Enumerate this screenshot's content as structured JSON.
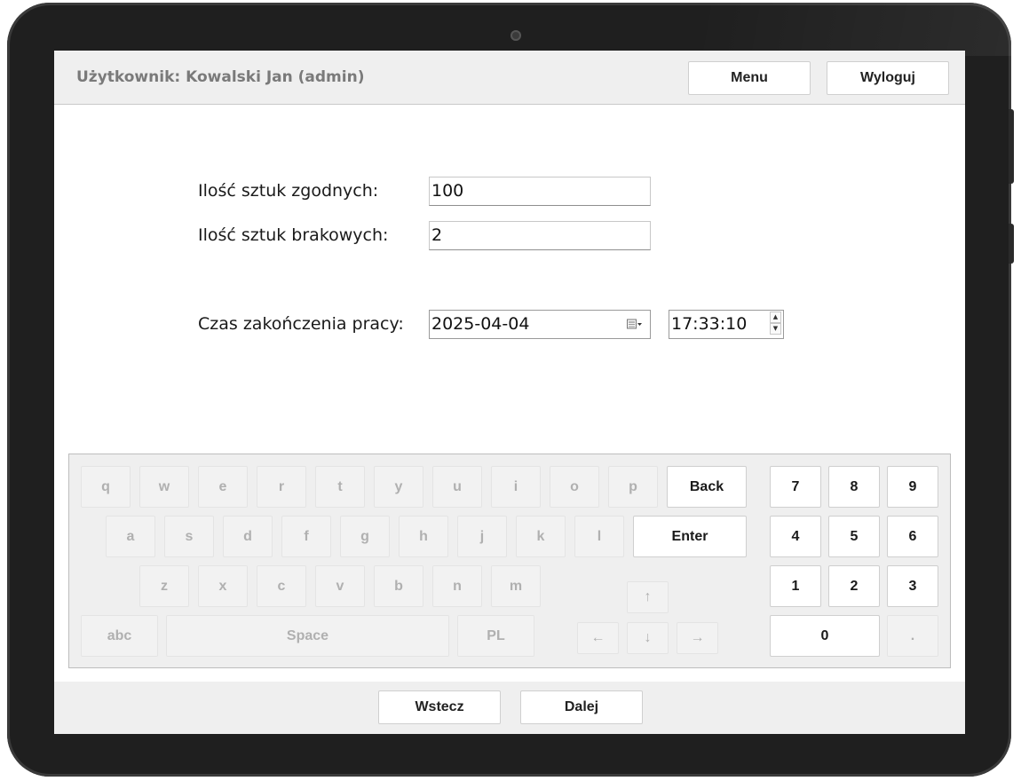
{
  "header": {
    "user_label": "Użytkownik: Kowalski Jan (admin)",
    "menu_label": "Menu",
    "logout_label": "Wyloguj"
  },
  "form": {
    "good_label": "Ilość sztuk zgodnych:",
    "good_value": "100",
    "defect_label": "Ilość sztuk brakowych:",
    "defect_value": "2",
    "end_label": "Czas zakończenia pracy:",
    "end_date": "2025-04-04",
    "end_time": "17:33:10"
  },
  "keyboard": {
    "row1": [
      "q",
      "w",
      "e",
      "r",
      "t",
      "y",
      "u",
      "i",
      "o",
      "p"
    ],
    "row2": [
      "a",
      "s",
      "d",
      "f",
      "g",
      "h",
      "j",
      "k",
      "l"
    ],
    "row3": [
      "z",
      "x",
      "c",
      "v",
      "b",
      "n",
      "m"
    ],
    "back": "Back",
    "enter": "Enter",
    "abc": "abc",
    "space": "Space",
    "pl": "PL",
    "arrow_up": "↑",
    "arrow_left": "←",
    "arrow_down": "↓",
    "arrow_right": "→",
    "num": [
      "7",
      "8",
      "9",
      "4",
      "5",
      "6",
      "1",
      "2",
      "3"
    ],
    "zero": "0",
    "dot": "."
  },
  "footer": {
    "back_label": "Wstecz",
    "next_label": "Dalej"
  }
}
